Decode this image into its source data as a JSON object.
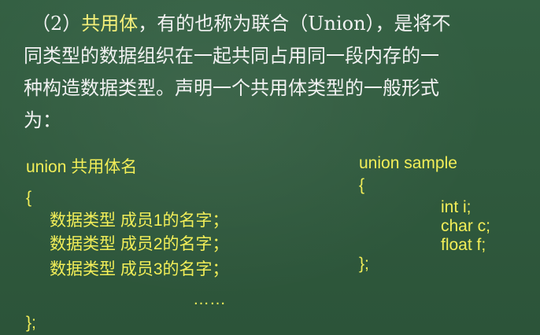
{
  "paragraph": {
    "lines": [
      {
        "prefix": "（2）",
        "highlight": "共用体",
        "rest": "，有的也称为联合（Union），是将不"
      },
      {
        "text": "同类型的数据组织在一起共同占用同一段内存的一"
      },
      {
        "text": "种构造数据类型。声明一个共用体类型的一般形式"
      },
      {
        "text": "为："
      }
    ]
  },
  "left_code": {
    "lines": [
      "union 共用体名",
      "{",
      "数据类型 成员1的名字；",
      "数据类型 成员2的名字；",
      "数据类型 成员3的名字；",
      "……",
      "};"
    ]
  },
  "right_code": {
    "lines": [
      "union sample",
      "{",
      "int i;",
      "char c;",
      "float f;",
      "};"
    ]
  },
  "colors": {
    "board": "#2f5a3e",
    "text": "#f2f2f2",
    "code": "#f2ee58"
  }
}
